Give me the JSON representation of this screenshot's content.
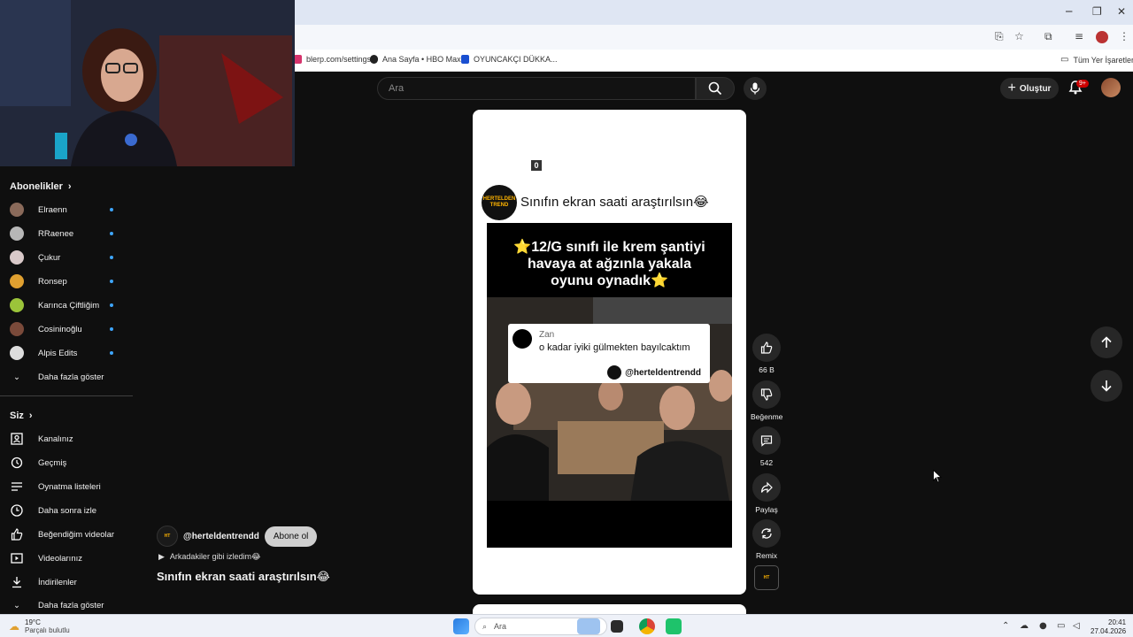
{
  "browser": {
    "bookmarks": [
      {
        "label": "blerp.com/settings",
        "color": "#d6336c"
      },
      {
        "label": "Ana Sayfa • HBO Max",
        "color": "#222222"
      },
      {
        "label": "OYUNCAKÇI DÜKKA...",
        "color": "#1a4fd1"
      }
    ],
    "all_bookmarks": "Tüm Yer İşaretleri"
  },
  "header": {
    "search_placeholder": "Ara",
    "create_label": "Oluştur",
    "notification_badge": "9+"
  },
  "sidebar": {
    "subscriptions_title": "Abonelikler",
    "subscriptions": [
      {
        "label": "Elraenn",
        "color": "#8a6a5a"
      },
      {
        "label": "RRaenee",
        "color": "#b7b7b7"
      },
      {
        "label": "Çukur",
        "color": "#d9c9c9"
      },
      {
        "label": "Ronsep",
        "color": "#e0a030"
      },
      {
        "label": "Karınca Çiftliğim",
        "color": "#9bc43a"
      },
      {
        "label": "Cosininoğlu",
        "color": "#7a4a3a"
      },
      {
        "label": "Alpis Edits",
        "color": "#dddddd"
      }
    ],
    "show_more_subs": "Daha fazla göster",
    "you_title": "Siz",
    "you_items": [
      {
        "label": "Kanalınız",
        "icon": "channel-icon"
      },
      {
        "label": "Geçmiş",
        "icon": "history-icon"
      },
      {
        "label": "Oynatma listeleri",
        "icon": "playlist-icon"
      },
      {
        "label": "Daha sonra izle",
        "icon": "clock-icon"
      },
      {
        "label": "Beğendiğim videolar",
        "icon": "like-icon"
      },
      {
        "label": "Videolarınız",
        "icon": "video-icon"
      },
      {
        "label": "İndirilenler",
        "icon": "download-icon"
      }
    ],
    "show_more_you": "Daha fazla göster"
  },
  "short": {
    "channel_handle": "@herteldentrendd",
    "subscribe_label": "Abone ol",
    "music": "Arkadakiler gibi izledim😂",
    "title": "Sınıfın ekran saati araştırılsın😂",
    "card_title": "Sınıfın ekran saati araştırılsın😂",
    "zero_badge": "0",
    "logo_text": "HERTELDEN TREND",
    "caption_lines": [
      "⭐12/G sınıfı ile krem şantiyi",
      "havaya at ağzınla yakala",
      "oyunu oynadık⭐"
    ],
    "quote_name": "Zan",
    "quote_text": "o kadar iyiki gülmekten bayılcaktım",
    "quote_handle": "@herteldentrendd"
  },
  "actions": {
    "likes": "66 B",
    "dislike": "Beğenme",
    "comments": "542",
    "share": "Paylaş",
    "remix": "Remix"
  },
  "taskbar": {
    "temp": "19°C",
    "weather": "Parçalı bulutlu",
    "search": "Ara",
    "time": "20:41",
    "date": "27.04.2026"
  }
}
